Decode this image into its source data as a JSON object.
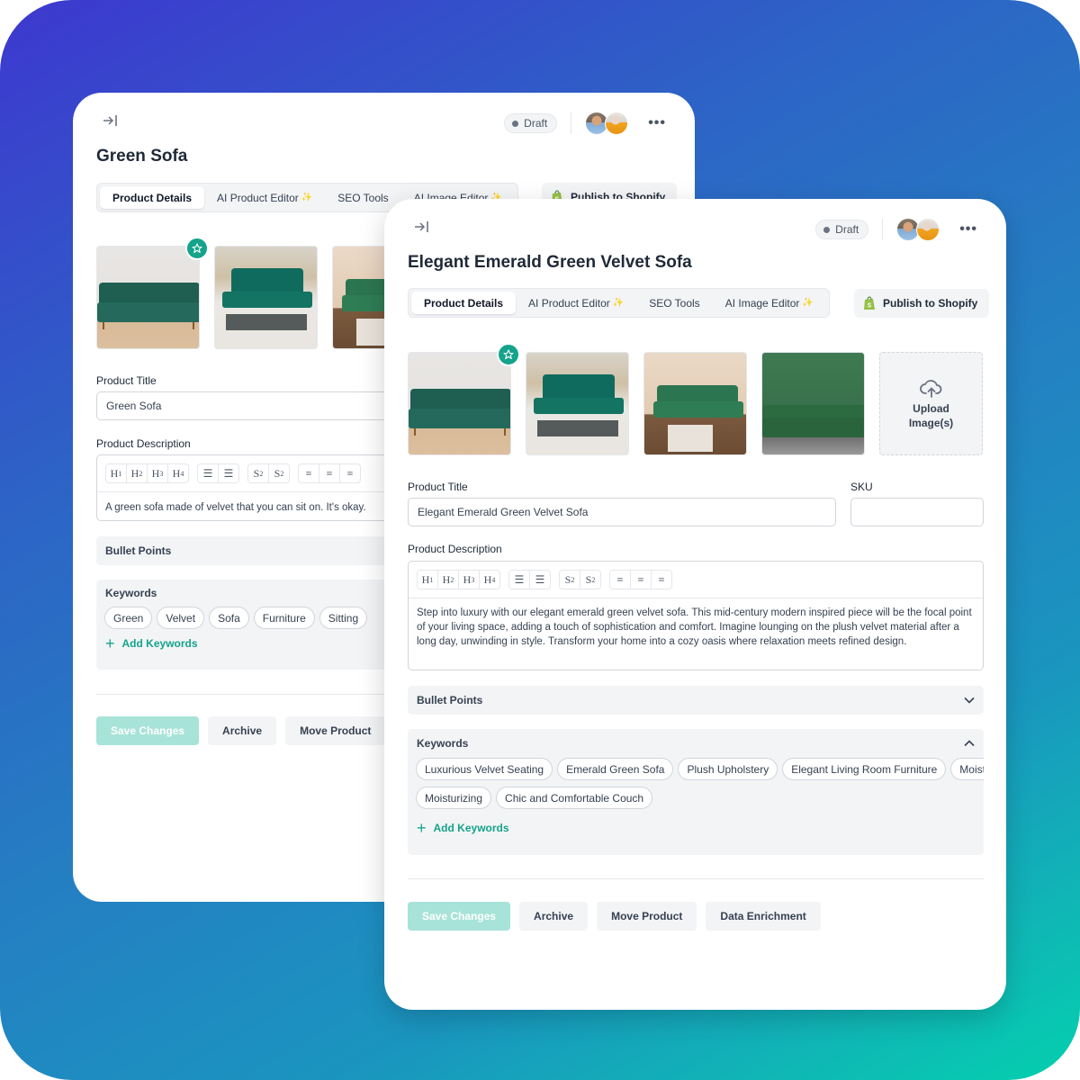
{
  "colors": {
    "accent": "#14a38b",
    "save_disabled": "#a7e3d8",
    "bg_gradient_start": "#3d38cf",
    "bg_gradient_end": "#03d0ae"
  },
  "back_card": {
    "status": "Draft",
    "title": "Green Sofa",
    "tabs": [
      {
        "label": "Product Details",
        "active": true
      },
      {
        "label": "AI Product Editor",
        "sparkle": true
      },
      {
        "label": "SEO Tools"
      },
      {
        "label": "AI Image Editor",
        "sparkle": true
      }
    ],
    "publish_label": "Publish to Shopify",
    "images": [
      "green velvet sofa",
      "green tufted sofa with coffee table",
      "green sofa with plant"
    ],
    "product_title_label": "Product Title",
    "product_title_value": "Green Sofa",
    "description_label": "Product Description",
    "description_value": "A green sofa made of velvet that you can sit on. It's okay.",
    "bullet_points_label": "Bullet Points",
    "keywords_label": "Keywords",
    "keywords": [
      "Green",
      "Velvet",
      "Sofa",
      "Furniture",
      "Sitting"
    ],
    "add_keywords_label": "Add Keywords",
    "buttons": {
      "save": "Save  Changes",
      "archive": "Archive",
      "move": "Move Product"
    }
  },
  "front_card": {
    "status": "Draft",
    "title": "Elegant Emerald Green Velvet Sofa",
    "tabs": [
      {
        "label": "Product Details",
        "active": true
      },
      {
        "label": "AI Product Editor",
        "sparkle": true
      },
      {
        "label": "SEO Tools"
      },
      {
        "label": "AI Image Editor",
        "sparkle": true
      }
    ],
    "publish_label": "Publish to Shopify",
    "images": [
      "green velvet sofa",
      "green tufted sofa with coffee table",
      "green sofa with plant on marble table",
      "green sofa against green wall"
    ],
    "upload_label": "Upload Image(s)",
    "product_title_label": "Product Title",
    "product_title_value": "Elegant Emerald Green Velvet Sofa",
    "sku_label": "SKU",
    "sku_value": "",
    "description_label": "Product Description",
    "description_value": "Step into luxury with our elegant emerald green velvet sofa. This mid-century modern inspired piece will be the focal point of your living space, adding a touch of sophistication and comfort. Imagine lounging on the plush velvet material after a long day, unwinding in style. Transform your home into a cozy oasis where relaxation meets refined design.",
    "bullet_points_label": "Bullet Points",
    "keywords_label": "Keywords",
    "keywords": [
      "Luxurious Velvet Seating",
      "Emerald Green Sofa",
      "Plush Upholstery",
      "Elegant Living Room Furniture",
      "Moistu",
      "Moisturizing",
      "Chic and Comfortable Couch"
    ],
    "add_keywords_label": "Add Keywords",
    "buttons": {
      "save": "Save  Changes",
      "archive": "Archive",
      "move": "Move Product",
      "enrich": "Data Enrichment"
    }
  },
  "toolbar": {
    "headings": [
      "H1",
      "H2",
      "H3",
      "H4"
    ],
    "lists": [
      "bullet-list",
      "numbered-list"
    ],
    "scripts": [
      "superscript",
      "subscript"
    ],
    "align": [
      "align-left",
      "align-center",
      "align-right"
    ]
  }
}
